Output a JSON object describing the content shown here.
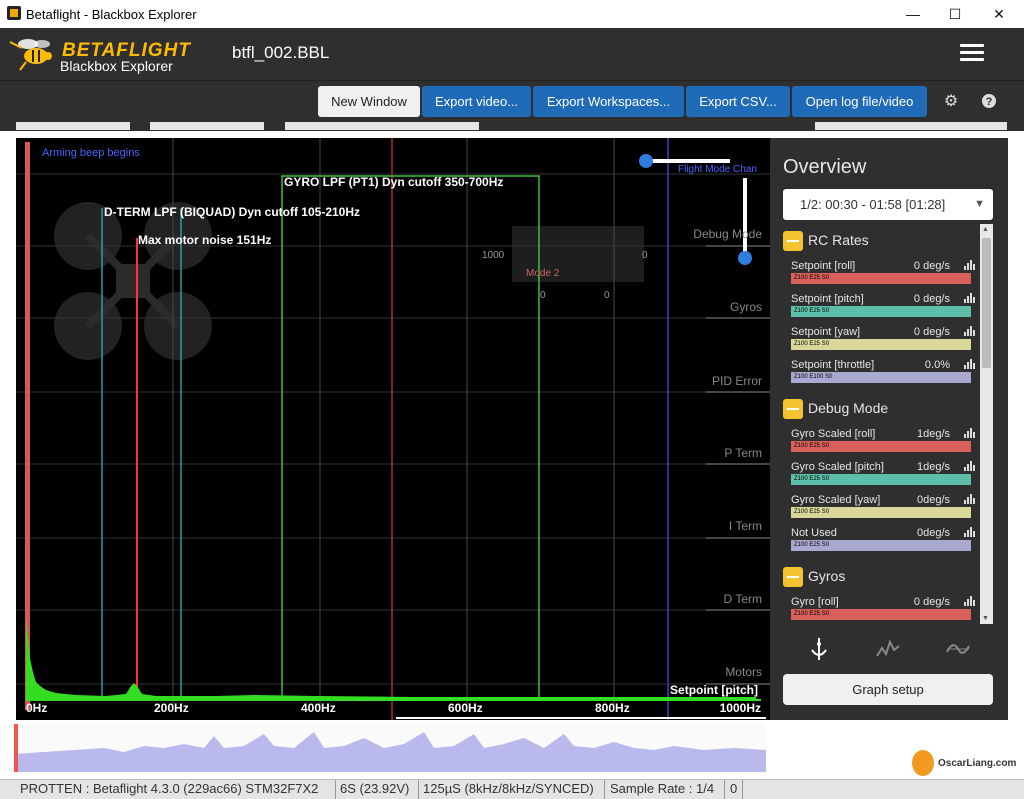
{
  "window": {
    "title": "Betaflight - Blackbox Explorer",
    "minimize": "—",
    "maximize": "☐",
    "close": "✕"
  },
  "header": {
    "brand_name": "BETAFLIGHT",
    "brand_sub": "Blackbox Explorer",
    "file_name": "btfl_002.BBL"
  },
  "toolbar": {
    "new_window": "New Window",
    "export_video": "Export video...",
    "export_workspaces": "Export Workspaces...",
    "export_csv": "Export CSV...",
    "open_log": "Open log file/video",
    "settings_icon": "gear-icon",
    "help_icon": "question-icon"
  },
  "graph": {
    "annotations": {
      "arming_beep": "Arming beep begins",
      "flight_mode": "Flight Mode Chan",
      "gyro_lpf": "GYRO LPF (PT1) Dyn cutoff 350-700Hz",
      "dterm_lpf": "D-TERM LPF (BIQUAD) Dyn cutoff 105-210Hz",
      "max_motor_noise": "Max motor noise 151Hz",
      "debug_mode": "Debug Mode",
      "gyros": "Gyros",
      "pid_error": "PID Error",
      "p_term": "P Term",
      "i_term": "I Term",
      "d_term": "D Term",
      "motors": "Motors",
      "setpoint_pitch": "Setpoint [pitch]",
      "stick_1000": "1000",
      "stick_0a": "0",
      "stick_0b": "0",
      "stick_0c": "0",
      "stick_mode": "Mode 2"
    },
    "x_ticks": [
      "0Hz",
      "200Hz",
      "400Hz",
      "600Hz",
      "800Hz",
      "1000Hz"
    ]
  },
  "overview": {
    "title": "Overview",
    "range": "1/2: 00:30 - 01:58 [01:28]",
    "groups": [
      {
        "label": "RC Rates",
        "rows": [
          {
            "name": "Setpoint [roll]",
            "value": "0 deg/s",
            "bar": "Z100 E25 S0",
            "color": "#d9605a"
          },
          {
            "name": "Setpoint [pitch]",
            "value": "0 deg/s",
            "bar": "Z100 E25 S0",
            "color": "#5dbfa8"
          },
          {
            "name": "Setpoint [yaw]",
            "value": "0 deg/s",
            "bar": "Z100 E25 S0",
            "color": "#d8d89a"
          },
          {
            "name": "Setpoint [throttle]",
            "value": "0.0%",
            "bar": "Z100 E100 S0",
            "color": "#a8a8d0"
          }
        ]
      },
      {
        "label": "Debug Mode",
        "rows": [
          {
            "name": "Gyro Scaled [roll]",
            "value": "1deg/s",
            "bar": "Z100 E25 S0",
            "color": "#d9605a"
          },
          {
            "name": "Gyro Scaled [pitch]",
            "value": "1deg/s",
            "bar": "Z100 E25 S0",
            "color": "#5dbfa8"
          },
          {
            "name": "Gyro Scaled [yaw]",
            "value": "0deg/s",
            "bar": "Z100 E25 S0",
            "color": "#d8d89a"
          },
          {
            "name": "Not Used",
            "value": "0deg/s",
            "bar": "Z100 E25 S0",
            "color": "#a8a8d0"
          }
        ]
      },
      {
        "label": "Gyros",
        "rows": [
          {
            "name": "Gyro [roll]",
            "value": "0 deg/s",
            "bar": "Z100 E25 S0",
            "color": "#d9605a"
          }
        ]
      }
    ],
    "graph_setup": "Graph setup"
  },
  "status": {
    "device": "PROTTEN : Betaflight 4.3.0 (229ac66) STM32F7X2",
    "battery": "6S (23.92V)",
    "looptime": "125µS (8kHz/8kHz/SYNCED)",
    "sample_rate": "Sample Rate : 1/4",
    "extra": "0"
  },
  "watermark": "OscarLiang.com"
}
